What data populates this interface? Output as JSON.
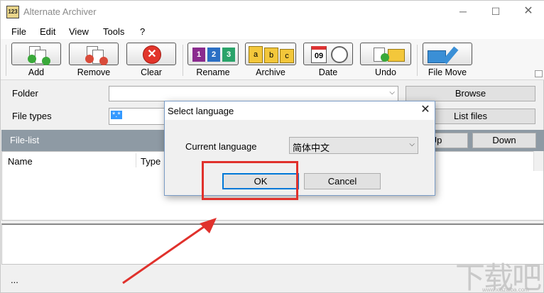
{
  "window": {
    "title": "Alternate Archiver",
    "app_icon_text": "123",
    "minimize_glyph": "─",
    "maximize_glyph": "☐",
    "close_glyph": "✕"
  },
  "menu": {
    "items": [
      "File",
      "Edit",
      "View",
      "Tools",
      "?"
    ]
  },
  "toolbar": {
    "buttons": [
      {
        "label": "Add",
        "icon": "add-files-icon"
      },
      {
        "label": "Remove",
        "icon": "remove-files-icon"
      },
      {
        "label": "Clear",
        "icon": "clear-icon"
      },
      {
        "label": "Rename",
        "icon": "rename-icon"
      },
      {
        "label": "Archive",
        "icon": "archive-icon"
      },
      {
        "label": "Date",
        "icon": "date-icon"
      },
      {
        "label": "Undo",
        "icon": "undo-icon"
      },
      {
        "label": "File Move",
        "icon": "file-move-icon"
      }
    ],
    "rename_digits": [
      "1",
      "2",
      "3"
    ],
    "archive_letters": [
      "a",
      "b",
      "c"
    ],
    "date_day": "09"
  },
  "form": {
    "folder_label": "Folder",
    "folder_value": "",
    "browse_label": "Browse",
    "filetypes_label": "File types",
    "filetypes_value": "*.*",
    "listfiles_label": "List files"
  },
  "filelist": {
    "title": "File-list",
    "up_label": "Up",
    "down_label": "Down",
    "columns": [
      "Name",
      "Type"
    ]
  },
  "status": {
    "text": "..."
  },
  "dialog": {
    "title": "Select language",
    "close_glyph": "✕",
    "current_language_label": "Current language",
    "current_language_value": "简体中文",
    "ok_label": "OK",
    "cancel_label": "Cancel"
  },
  "watermark": {
    "text": "下载吧",
    "url": "www.xiazaiba.com"
  },
  "colors": {
    "filelist_header": "#8e9aa4",
    "annotation_red": "#e0312c",
    "focus_blue": "#0078d7",
    "selection_blue": "#3399ff"
  }
}
